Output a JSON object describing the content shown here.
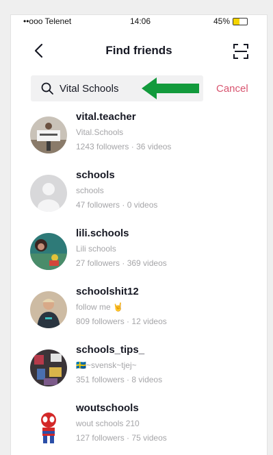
{
  "status_bar": {
    "carrier": "••ooo Telenet",
    "time": "14:06",
    "battery": "45%",
    "battery_level": 0.45
  },
  "header": {
    "title": "Find friends"
  },
  "search": {
    "value": "Vital Schools",
    "cancel_label": "Cancel"
  },
  "colors": {
    "accent": "#d8546f",
    "arrow": "#129a3c",
    "muted": "#a5a5a8"
  },
  "results": [
    {
      "username": "vital.teacher",
      "display_name": "Vital.Schools",
      "followers": "1243 followers",
      "videos": "36 videos"
    },
    {
      "username": "schools",
      "display_name": "schools",
      "followers": "47 followers",
      "videos": "0 videos"
    },
    {
      "username": "lili.schools",
      "display_name": "Lili schools",
      "followers": "27 followers",
      "videos": "369 videos"
    },
    {
      "username": "schoolshit12",
      "display_name": "follow me 🤘",
      "followers": "809 followers",
      "videos": "12 videos"
    },
    {
      "username": "schools_tips_",
      "display_name": "🇸🇪~svensk~tjej~",
      "followers": "351 followers",
      "videos": "8 videos"
    },
    {
      "username": "woutschools",
      "display_name": "wout schools 210",
      "followers": "127 followers",
      "videos": "75 videos"
    }
  ]
}
